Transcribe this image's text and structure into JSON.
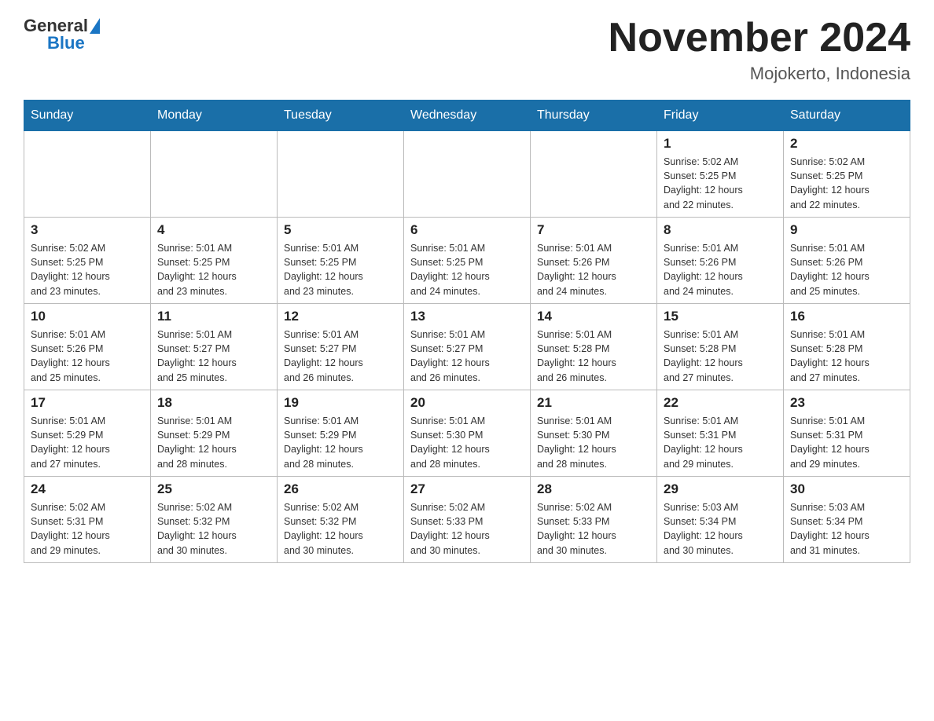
{
  "header": {
    "logo": {
      "general": "General",
      "blue": "Blue"
    },
    "title": "November 2024",
    "location": "Mojokerto, Indonesia"
  },
  "calendar": {
    "days_of_week": [
      "Sunday",
      "Monday",
      "Tuesday",
      "Wednesday",
      "Thursday",
      "Friday",
      "Saturday"
    ],
    "weeks": [
      {
        "days": [
          {
            "number": "",
            "info": ""
          },
          {
            "number": "",
            "info": ""
          },
          {
            "number": "",
            "info": ""
          },
          {
            "number": "",
            "info": ""
          },
          {
            "number": "",
            "info": ""
          },
          {
            "number": "1",
            "info": "Sunrise: 5:02 AM\nSunset: 5:25 PM\nDaylight: 12 hours\nand 22 minutes."
          },
          {
            "number": "2",
            "info": "Sunrise: 5:02 AM\nSunset: 5:25 PM\nDaylight: 12 hours\nand 22 minutes."
          }
        ]
      },
      {
        "days": [
          {
            "number": "3",
            "info": "Sunrise: 5:02 AM\nSunset: 5:25 PM\nDaylight: 12 hours\nand 23 minutes."
          },
          {
            "number": "4",
            "info": "Sunrise: 5:01 AM\nSunset: 5:25 PM\nDaylight: 12 hours\nand 23 minutes."
          },
          {
            "number": "5",
            "info": "Sunrise: 5:01 AM\nSunset: 5:25 PM\nDaylight: 12 hours\nand 23 minutes."
          },
          {
            "number": "6",
            "info": "Sunrise: 5:01 AM\nSunset: 5:25 PM\nDaylight: 12 hours\nand 24 minutes."
          },
          {
            "number": "7",
            "info": "Sunrise: 5:01 AM\nSunset: 5:26 PM\nDaylight: 12 hours\nand 24 minutes."
          },
          {
            "number": "8",
            "info": "Sunrise: 5:01 AM\nSunset: 5:26 PM\nDaylight: 12 hours\nand 24 minutes."
          },
          {
            "number": "9",
            "info": "Sunrise: 5:01 AM\nSunset: 5:26 PM\nDaylight: 12 hours\nand 25 minutes."
          }
        ]
      },
      {
        "days": [
          {
            "number": "10",
            "info": "Sunrise: 5:01 AM\nSunset: 5:26 PM\nDaylight: 12 hours\nand 25 minutes."
          },
          {
            "number": "11",
            "info": "Sunrise: 5:01 AM\nSunset: 5:27 PM\nDaylight: 12 hours\nand 25 minutes."
          },
          {
            "number": "12",
            "info": "Sunrise: 5:01 AM\nSunset: 5:27 PM\nDaylight: 12 hours\nand 26 minutes."
          },
          {
            "number": "13",
            "info": "Sunrise: 5:01 AM\nSunset: 5:27 PM\nDaylight: 12 hours\nand 26 minutes."
          },
          {
            "number": "14",
            "info": "Sunrise: 5:01 AM\nSunset: 5:28 PM\nDaylight: 12 hours\nand 26 minutes."
          },
          {
            "number": "15",
            "info": "Sunrise: 5:01 AM\nSunset: 5:28 PM\nDaylight: 12 hours\nand 27 minutes."
          },
          {
            "number": "16",
            "info": "Sunrise: 5:01 AM\nSunset: 5:28 PM\nDaylight: 12 hours\nand 27 minutes."
          }
        ]
      },
      {
        "days": [
          {
            "number": "17",
            "info": "Sunrise: 5:01 AM\nSunset: 5:29 PM\nDaylight: 12 hours\nand 27 minutes."
          },
          {
            "number": "18",
            "info": "Sunrise: 5:01 AM\nSunset: 5:29 PM\nDaylight: 12 hours\nand 28 minutes."
          },
          {
            "number": "19",
            "info": "Sunrise: 5:01 AM\nSunset: 5:29 PM\nDaylight: 12 hours\nand 28 minutes."
          },
          {
            "number": "20",
            "info": "Sunrise: 5:01 AM\nSunset: 5:30 PM\nDaylight: 12 hours\nand 28 minutes."
          },
          {
            "number": "21",
            "info": "Sunrise: 5:01 AM\nSunset: 5:30 PM\nDaylight: 12 hours\nand 28 minutes."
          },
          {
            "number": "22",
            "info": "Sunrise: 5:01 AM\nSunset: 5:31 PM\nDaylight: 12 hours\nand 29 minutes."
          },
          {
            "number": "23",
            "info": "Sunrise: 5:01 AM\nSunset: 5:31 PM\nDaylight: 12 hours\nand 29 minutes."
          }
        ]
      },
      {
        "days": [
          {
            "number": "24",
            "info": "Sunrise: 5:02 AM\nSunset: 5:31 PM\nDaylight: 12 hours\nand 29 minutes."
          },
          {
            "number": "25",
            "info": "Sunrise: 5:02 AM\nSunset: 5:32 PM\nDaylight: 12 hours\nand 30 minutes."
          },
          {
            "number": "26",
            "info": "Sunrise: 5:02 AM\nSunset: 5:32 PM\nDaylight: 12 hours\nand 30 minutes."
          },
          {
            "number": "27",
            "info": "Sunrise: 5:02 AM\nSunset: 5:33 PM\nDaylight: 12 hours\nand 30 minutes."
          },
          {
            "number": "28",
            "info": "Sunrise: 5:02 AM\nSunset: 5:33 PM\nDaylight: 12 hours\nand 30 minutes."
          },
          {
            "number": "29",
            "info": "Sunrise: 5:03 AM\nSunset: 5:34 PM\nDaylight: 12 hours\nand 30 minutes."
          },
          {
            "number": "30",
            "info": "Sunrise: 5:03 AM\nSunset: 5:34 PM\nDaylight: 12 hours\nand 31 minutes."
          }
        ]
      }
    ]
  }
}
